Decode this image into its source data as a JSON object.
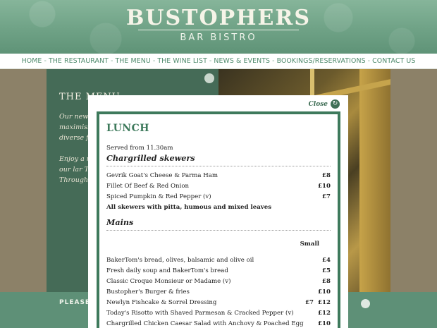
{
  "header": {
    "brand": "BUSTOPHERS",
    "subtitle": "BAR BISTRO"
  },
  "nav": {
    "items": [
      "HOME",
      "THE RESTAURANT",
      "THE MENU",
      "THE WINE LIST",
      "NEWS & EVENTS",
      "BOOKINGS/RESERVATIONS",
      "CONTACT US"
    ],
    "separator": "-"
  },
  "background_page": {
    "title": "THE MENU",
    "paragraphs": [
      "Our new serves a the very chefs pro maximisi waters. Cornwall always b diverse fi",
      "Enjoy a r Daily Tel glass of Fal muss in our lar Tregothn one to a bottle of Throughc"
    ],
    "footer_text": "PLEASE"
  },
  "modal": {
    "close_label": "Close",
    "heading": "LUNCH",
    "served": "Served from 11.30am",
    "sections": [
      {
        "title": "Chargrilled skewers",
        "items": [
          {
            "name": "Gevrik Goat's Cheese & Parma Ham",
            "price": "£8"
          },
          {
            "name": "Fillet Of Beef & Red Onion",
            "price": "£10"
          },
          {
            "name": "Spiced Pumpkin & Red Pepper (v)",
            "price": "£7"
          }
        ],
        "note": "All skewers with pitta, humous and mixed leaves"
      },
      {
        "title": "Mains",
        "column_header": "Small",
        "items": [
          {
            "name": "BakerTom's bread, olives, balsamic and olive oil",
            "small": "",
            "price": "£4"
          },
          {
            "name": "Fresh daily soup and BakerTom's bread",
            "small": "",
            "price": "£5"
          },
          {
            "name": "Classic Croque Monsieur or Madame (v)",
            "small": "",
            "price": "£8"
          },
          {
            "name": "Bustopher's Burger & fries",
            "small": "",
            "price": "£10"
          },
          {
            "name": "Newlyn Fishcake & Sorrel Dressing",
            "small": "£7",
            "price": "£12"
          },
          {
            "name": "Today's Risotto with Shaved Parmesan & Cracked Pepper (v)",
            "small": "",
            "price": "£12"
          },
          {
            "name": "Chargrilled Chicken Caesar Salad with Anchovy & Poached Egg",
            "small": "",
            "price": "£10"
          }
        ]
      }
    ]
  }
}
